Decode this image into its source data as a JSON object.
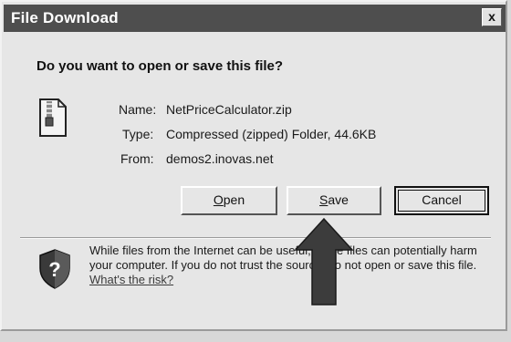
{
  "dialog": {
    "title": "File Download",
    "close_label": "x",
    "question": "Do you want to open or save this file?",
    "name_label": "Name:",
    "name_value": "NetPriceCalculator.zip",
    "type_label": "Type:",
    "type_value": "Compressed (zipped) Folder, 44.6KB",
    "from_label": "From:",
    "from_value": "demos2.inovas.net",
    "buttons": {
      "open_first": "O",
      "open_rest": "pen",
      "save_first": "S",
      "save_rest": "ave",
      "cancel": "Cancel"
    },
    "warning_text": "While files from the Internet can be useful, some files can potentially harm your computer. If you do not trust the source, do not open or save this file.",
    "risk_link": "What's the risk?"
  },
  "icons": {
    "file": "zip-folder-icon",
    "security": "shield-question-icon",
    "pointer": "arrow-up-icon"
  }
}
